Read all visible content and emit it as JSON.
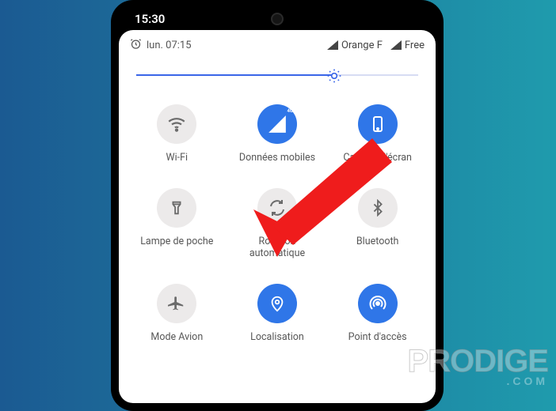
{
  "phone": {
    "outer_time": "15:30"
  },
  "status": {
    "alarm_day_time": "lun. 07:15",
    "sim1": "Orange F",
    "sim2": "Free"
  },
  "brightness": {
    "percent": 70
  },
  "tiles": [
    {
      "key": "wifi",
      "label": "Wi-Fi",
      "active": false
    },
    {
      "key": "data",
      "label": "Données\nmobiles",
      "active": true
    },
    {
      "key": "screenshot",
      "label": "Capture d'écran",
      "active": true
    },
    {
      "key": "flashlight",
      "label": "Lampe de\npoche",
      "active": false
    },
    {
      "key": "rotation",
      "label": "Rotation\nautomatique",
      "active": false
    },
    {
      "key": "bluetooth",
      "label": "Bluetooth",
      "active": false
    },
    {
      "key": "airplane",
      "label": "Mode Avion",
      "active": false
    },
    {
      "key": "location",
      "label": "Localisation",
      "active": true
    },
    {
      "key": "hotspot",
      "label": "Point d'accès",
      "active": true
    }
  ],
  "watermark": {
    "brand": "PRODIGE",
    "sub": ".COM"
  }
}
